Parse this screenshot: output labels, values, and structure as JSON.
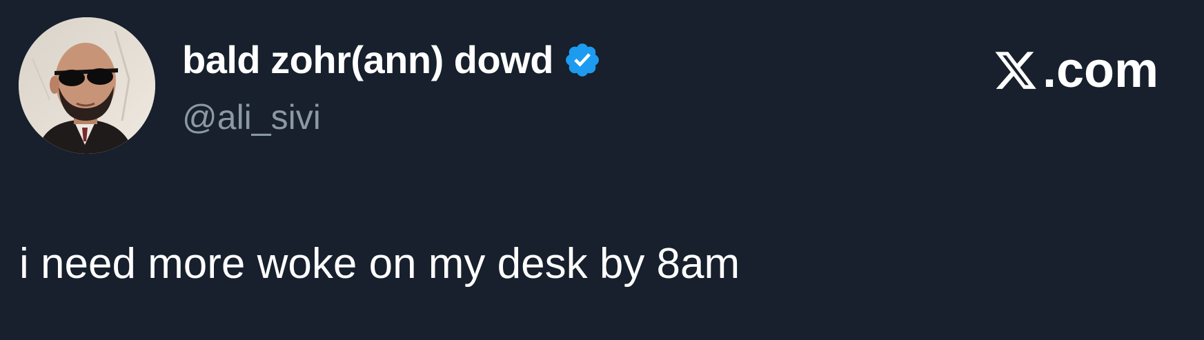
{
  "tweet": {
    "display_name": "bald zohr(ann) dowd",
    "handle": "@ali_sivi",
    "text": "i need more woke on my desk by 8am",
    "verified": true
  },
  "brand": {
    "label": ".com"
  },
  "icons": {
    "verified": "verified-badge-icon",
    "logo": "x-logo-icon",
    "avatar": "profile-photo"
  },
  "colors": {
    "background": "#17202c",
    "name": "#ffffff",
    "handle": "#8b98a5",
    "verified": "#1d9bf0"
  }
}
